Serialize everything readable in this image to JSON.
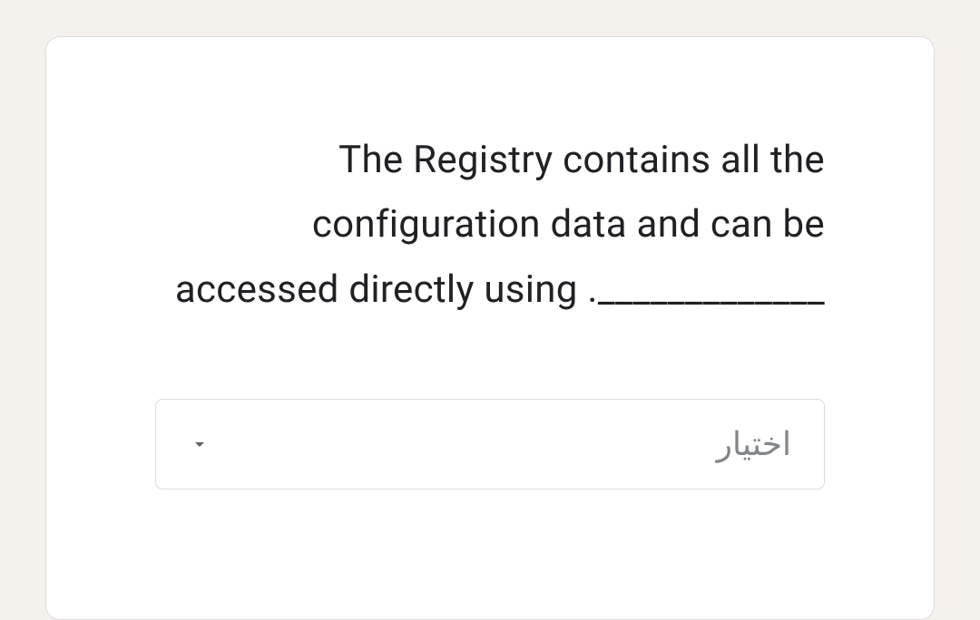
{
  "question": {
    "text": "The Registry contains all the configuration data and can be accessed directly using ._____________"
  },
  "dropdown": {
    "placeholder": "اختيار"
  }
}
